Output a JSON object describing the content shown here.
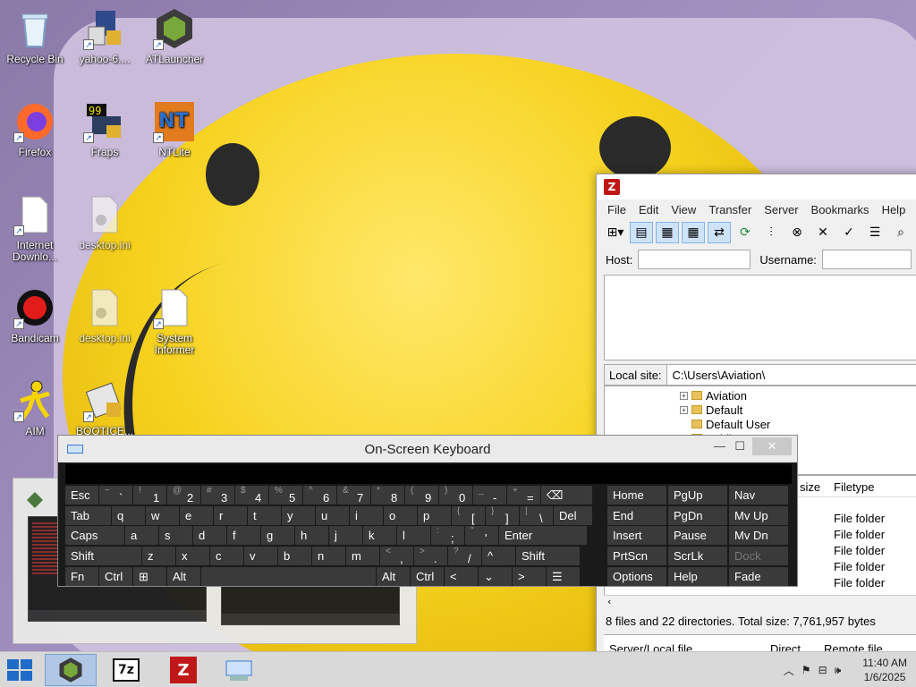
{
  "desktop_icons": [
    {
      "label": "Recycle Bin",
      "icon": "recycle-bin-icon"
    },
    {
      "label": "yahoo-6....",
      "icon": "installer-icon"
    },
    {
      "label": "ATLauncher",
      "icon": "atlauncher-icon"
    },
    {
      "label": "Firefox",
      "icon": "firefox-icon"
    },
    {
      "label": "Fraps",
      "icon": "fraps-icon"
    },
    {
      "label": "NTLite",
      "icon": "ntlite-icon"
    },
    {
      "label": "Internet Downlo...",
      "icon": "document-icon"
    },
    {
      "label": "desktop.ini",
      "icon": "ini-file-icon"
    },
    {
      "label": "Bandicam",
      "icon": "bandicam-icon"
    },
    {
      "label": "desktop.ini",
      "icon": "ini-file-icon"
    },
    {
      "label": "System Informer",
      "icon": "document-icon"
    },
    {
      "label": "AIM",
      "icon": "aim-icon"
    },
    {
      "label": "BOOTICE...",
      "icon": "bootice-icon"
    }
  ],
  "filezilla": {
    "logo": "Z",
    "menu": [
      "File",
      "Edit",
      "View",
      "Transfer",
      "Server",
      "Bookmarks",
      "Help"
    ],
    "quickconnect": {
      "host_label": "Host:",
      "host_value": "",
      "username_label": "Username:",
      "username_value": ""
    },
    "local_site_label": "Local site:",
    "local_site_path": "C:\\Users\\Aviation\\",
    "tree": [
      "Aviation",
      "Default",
      "Default User",
      "Public"
    ],
    "list_headers": {
      "size": "size",
      "filetype": "Filetype"
    },
    "rows": [
      "File folder",
      "File folder",
      "File folder",
      "File folder",
      "File folder"
    ],
    "status": "8 files and 22 directories. Total size: 7,761,957 bytes",
    "queue_headers": {
      "server_local": "Server/Local file",
      "direction": "Direct...",
      "remote": "Remote file"
    }
  },
  "osk": {
    "title": "On-Screen Keyboard",
    "rows": [
      [
        {
          "main": "Esc"
        },
        {
          "sub": "~",
          "main": "`"
        },
        {
          "sub": "!",
          "main": "1"
        },
        {
          "sub": "@",
          "main": "2"
        },
        {
          "sub": "#",
          "main": "3"
        },
        {
          "sub": "$",
          "main": "4"
        },
        {
          "sub": "%",
          "main": "5"
        },
        {
          "sub": "^",
          "main": "6"
        },
        {
          "sub": "&",
          "main": "7"
        },
        {
          "sub": "*",
          "main": "8"
        },
        {
          "sub": "(",
          "main": "9"
        },
        {
          "sub": ")",
          "main": "0"
        },
        {
          "sub": "_",
          "main": "-"
        },
        {
          "sub": "+",
          "main": "="
        },
        {
          "main": "⌫"
        }
      ],
      [
        {
          "main": "Tab"
        },
        {
          "main": "q"
        },
        {
          "main": "w"
        },
        {
          "main": "e"
        },
        {
          "main": "r"
        },
        {
          "main": "t"
        },
        {
          "main": "y"
        },
        {
          "main": "u"
        },
        {
          "main": "i"
        },
        {
          "main": "o"
        },
        {
          "main": "p"
        },
        {
          "sub": "{",
          "main": "["
        },
        {
          "sub": "}",
          "main": "]"
        },
        {
          "sub": "|",
          "main": "\\"
        },
        {
          "main": "Del"
        }
      ],
      [
        {
          "main": "Caps"
        },
        {
          "main": "a"
        },
        {
          "main": "s"
        },
        {
          "main": "d"
        },
        {
          "main": "f"
        },
        {
          "main": "g"
        },
        {
          "main": "h"
        },
        {
          "main": "j"
        },
        {
          "main": "k"
        },
        {
          "main": "l"
        },
        {
          "sub": ":",
          "main": ";"
        },
        {
          "sub": "\"",
          "main": "'"
        },
        {
          "main": "Enter"
        }
      ],
      [
        {
          "main": "Shift"
        },
        {
          "main": "z"
        },
        {
          "main": "x"
        },
        {
          "main": "c"
        },
        {
          "main": "v"
        },
        {
          "main": "b"
        },
        {
          "main": "n"
        },
        {
          "main": "m"
        },
        {
          "sub": "<",
          "main": ","
        },
        {
          "sub": ">",
          "main": "."
        },
        {
          "sub": "?",
          "main": "/"
        },
        {
          "main": "^"
        },
        {
          "main": "Shift"
        }
      ],
      [
        {
          "main": "Fn"
        },
        {
          "main": "Ctrl"
        },
        {
          "main": "⊞"
        },
        {
          "main": "Alt"
        },
        {
          "main": ""
        },
        {
          "main": "Alt"
        },
        {
          "main": "Ctrl"
        },
        {
          "main": "<"
        },
        {
          "main": "⌄"
        },
        {
          "main": ">"
        },
        {
          "main": "☰"
        }
      ]
    ],
    "nav": [
      [
        "Home",
        "PgUp",
        "Nav"
      ],
      [
        "End",
        "PgDn",
        "Mv Up"
      ],
      [
        "Insert",
        "Pause",
        "Mv Dn"
      ],
      [
        "PrtScn",
        "ScrLk",
        "Dock"
      ],
      [
        "Options",
        "Help",
        "Fade"
      ]
    ]
  },
  "taskbar": {
    "apps": [
      "atlauncher-icon",
      "7zip-icon",
      "filezilla-icon",
      "osk-icon"
    ],
    "labels": {
      "7zip": "7z",
      "filezilla": "Z"
    },
    "time": "11:40 AM",
    "date": "1/6/2025"
  },
  "colors": {
    "accent": "#1e6cc8",
    "filezilla_red": "#c01818",
    "osk_bg": "#1a1a1a"
  }
}
